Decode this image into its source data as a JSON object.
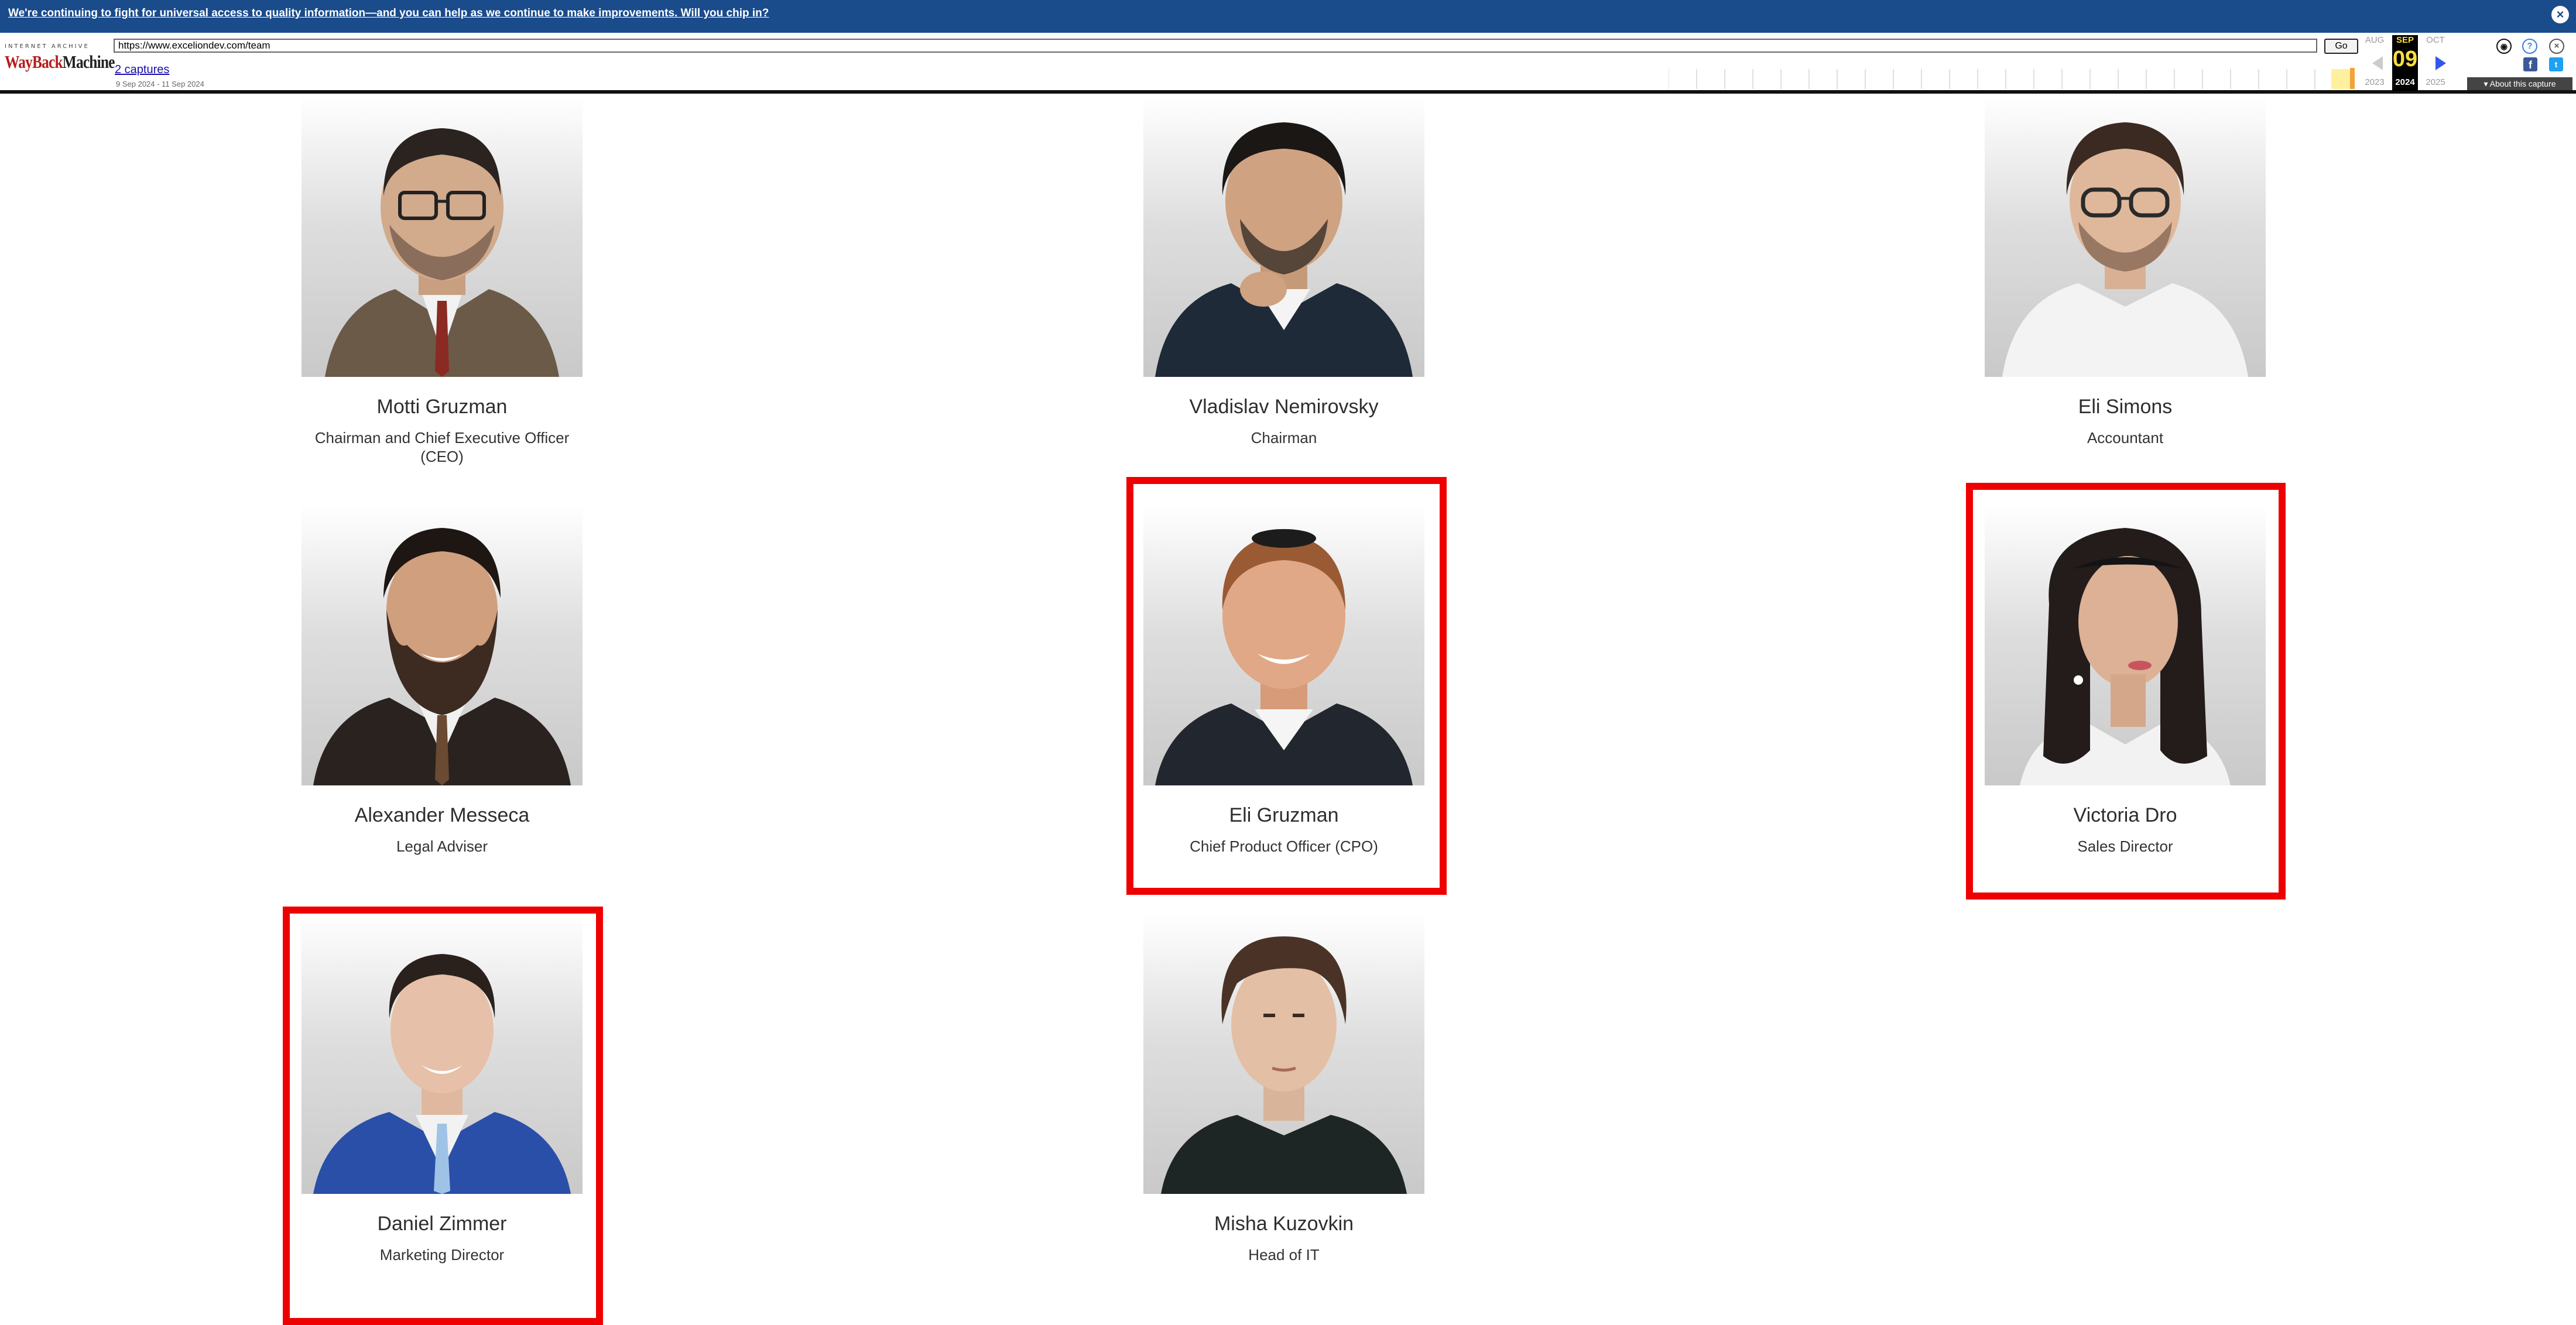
{
  "banner": {
    "text": "We're continuing to fight for universal access to quality information—and you can help as we continue to make improvements. Will you chip in?"
  },
  "wayback": {
    "logo_small": "INTERNET ARCHIVE",
    "logo_main_red": "WayBack",
    "logo_main_dark": "Machine",
    "url": "https://www.exceliondev.com/team",
    "go_label": "Go",
    "captures_link": "2 captures",
    "capture_range": "9 Sep 2024 - 11 Sep 2024",
    "months": [
      "AUG",
      "SEP",
      "OCT"
    ],
    "day": "09",
    "years": [
      "2023",
      "2024",
      "2025"
    ],
    "about_label": "▾ About this capture"
  },
  "team": [
    {
      "name": "Motti Gruzman",
      "role": "Chairman and Chief Executive Officer (CEO)",
      "highlighted": false
    },
    {
      "name": "Vladislav Nemirovsky",
      "role": "Chairman",
      "highlighted": false
    },
    {
      "name": "Eli Simons",
      "role": "Accountant",
      "highlighted": false
    },
    {
      "name": "Alexander Messeca",
      "role": "Legal Adviser",
      "highlighted": false
    },
    {
      "name": "Eli Gruzman",
      "role": "Chief Product Officer (CPO)",
      "highlighted": true
    },
    {
      "name": "Victoria Dro",
      "role": "Sales Director",
      "highlighted": true
    },
    {
      "name": "Daniel Zimmer",
      "role": "Marketing Director",
      "highlighted": true
    },
    {
      "name": "Misha Kuzovkin",
      "role": "Head of IT",
      "highlighted": false
    }
  ],
  "colors": {
    "banner_bg": "#1a4b8b",
    "highlight": "#ee0000"
  }
}
